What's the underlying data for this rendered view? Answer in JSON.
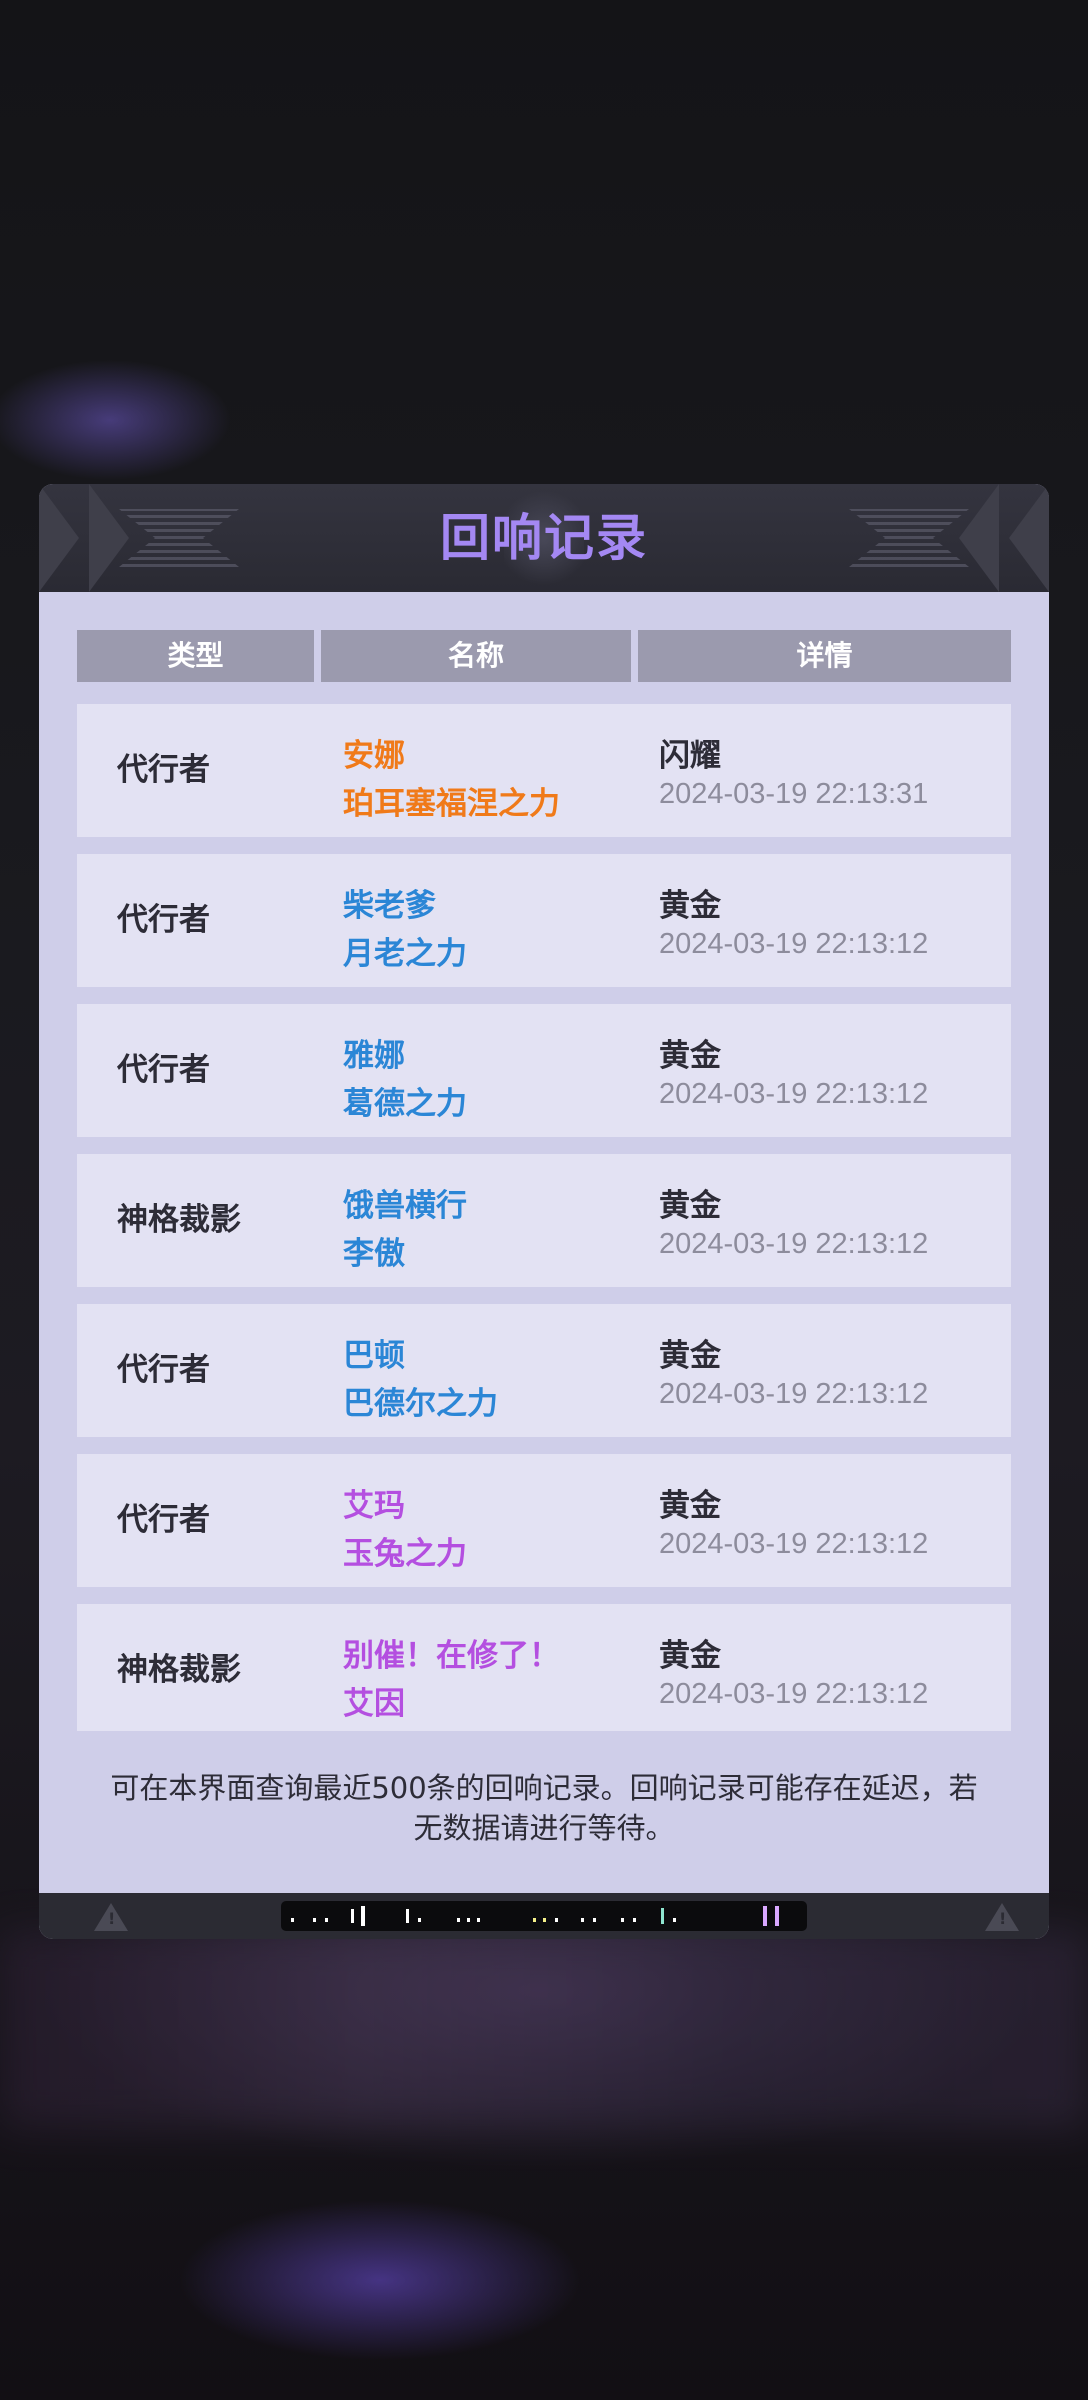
{
  "dialog": {
    "title": "回响记录",
    "columns": [
      "类型",
      "名称",
      "详情"
    ],
    "records": [
      {
        "type": "代行者",
        "name_line1": "安娜",
        "name_line2": "珀耳塞福涅之力",
        "name_color": "#f07a19",
        "rarity": "闪耀",
        "time": "2024-03-19 22:13:31"
      },
      {
        "type": "代行者",
        "name_line1": "柴老爹",
        "name_line2": "月老之力",
        "name_color": "#2b86d6",
        "rarity": "黄金",
        "time": "2024-03-19 22:13:12"
      },
      {
        "type": "代行者",
        "name_line1": "雅娜",
        "name_line2": "葛德之力",
        "name_color": "#2b86d6",
        "rarity": "黄金",
        "time": "2024-03-19 22:13:12"
      },
      {
        "type": "神格裁影",
        "name_line1": "饿兽横行",
        "name_line2": "李傲",
        "name_color": "#2b86d6",
        "rarity": "黄金",
        "time": "2024-03-19 22:13:12"
      },
      {
        "type": "代行者",
        "name_line1": "巴顿",
        "name_line2": "巴德尔之力",
        "name_color": "#2b86d6",
        "rarity": "黄金",
        "time": "2024-03-19 22:13:12"
      },
      {
        "type": "代行者",
        "name_line1": "艾玛",
        "name_line2": "玉兔之力",
        "name_color": "#b44fe0",
        "rarity": "黄金",
        "time": "2024-03-19 22:13:12"
      },
      {
        "type": "神格裁影",
        "name_line1": "别催！在修了！",
        "name_line2": "艾因",
        "name_color": "#b44fe0",
        "rarity": "黄金",
        "time": "2024-03-19 22:13:12"
      }
    ],
    "note": "可在本界面查询最近500条的回响记录。回响记录可能存在延迟，若无数据请进行等待。"
  },
  "icons": {
    "footer_left": "warning-icon",
    "footer_right": "warning-icon",
    "footer_center": "barcode-decoration"
  },
  "colors": {
    "title": "#a488f3",
    "panel_bg": "#cfcee9",
    "row_bg": "#e3e2f3",
    "header_bg": "#9b9aae"
  }
}
